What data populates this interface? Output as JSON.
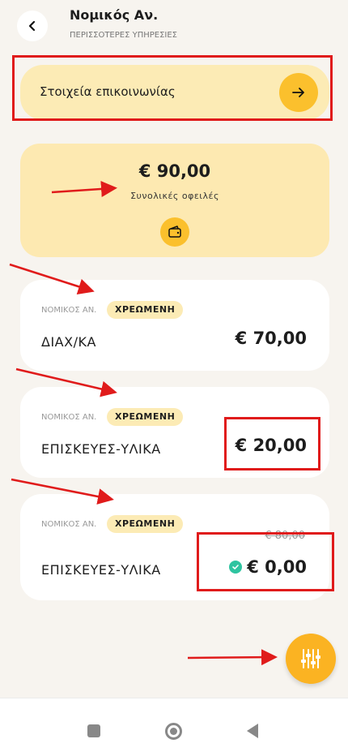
{
  "header": {
    "title": "Νομικός Αν.",
    "subtitle": "ΠΕΡΙΣΣΟΤΕΡΕΣ ΥΠΗΡΕΣΙΕΣ"
  },
  "contact": {
    "label": "Στοιχεία επικοινωνίας"
  },
  "summary": {
    "total": "€ 90,00",
    "label": "Συνολικές οφειλές"
  },
  "items": [
    {
      "owner": "ΝΟΜΙΚΟΣ ΑΝ.",
      "status": "ΧΡΕΩΜΕΝΗ",
      "name": "ΔΙΑΧ/ΚΑ",
      "price": "€ 70,00"
    },
    {
      "owner": "ΝΟΜΙΚΟΣ ΑΝ.",
      "status": "ΧΡΕΩΜΕΝΗ",
      "name": "ΕΠΙΣΚΕΥΕΣ-ΥΛΙΚΑ",
      "price": "€ 20,00"
    },
    {
      "owner": "ΝΟΜΙΚΟΣ ΑΝ.",
      "status": "ΧΡΕΩΜΕΝΗ",
      "name": "ΕΠΙΣΚΕΥΕΣ-ΥΛΙΚΑ",
      "price": "€ 0,00",
      "old_price": "€ 80,00"
    }
  ],
  "icons": {
    "back": "chevron-left-icon",
    "contact_arrow": "arrow-right-icon",
    "wallet": "wallet-icon",
    "paid": "check-circle-icon",
    "filter": "sliders-icon"
  },
  "colors": {
    "background": "#f7f4ef",
    "accent": "#fbc02d",
    "card_yellow": "#fde9b1",
    "badge": "#fcebb5",
    "paid_green": "#2ec4a0",
    "annotation_red": "#e01b1b"
  }
}
